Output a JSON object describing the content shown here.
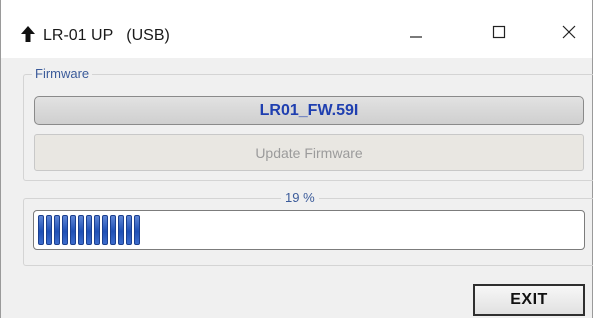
{
  "window": {
    "title": "LR-01 UP   (USB)",
    "title_icon": "arrow-up-icon",
    "controls": {
      "minimize_icon": "minimize-icon",
      "maximize_icon": "maximize-icon",
      "close_icon": "close-icon"
    }
  },
  "firmware": {
    "group_label": "Firmware",
    "name": "LR01_FW.59I",
    "update_button_label": "Update Firmware",
    "update_button_enabled": false
  },
  "progress": {
    "label": "19 %",
    "fraction": 0.19
  },
  "footer": {
    "exit_label": "EXIT"
  },
  "colors": {
    "group_label": "#3b5b9a",
    "firmware_name": "#1f3fb0",
    "progress_fill": "#1e4fb5",
    "disabled_text": "#9b9b9b"
  }
}
